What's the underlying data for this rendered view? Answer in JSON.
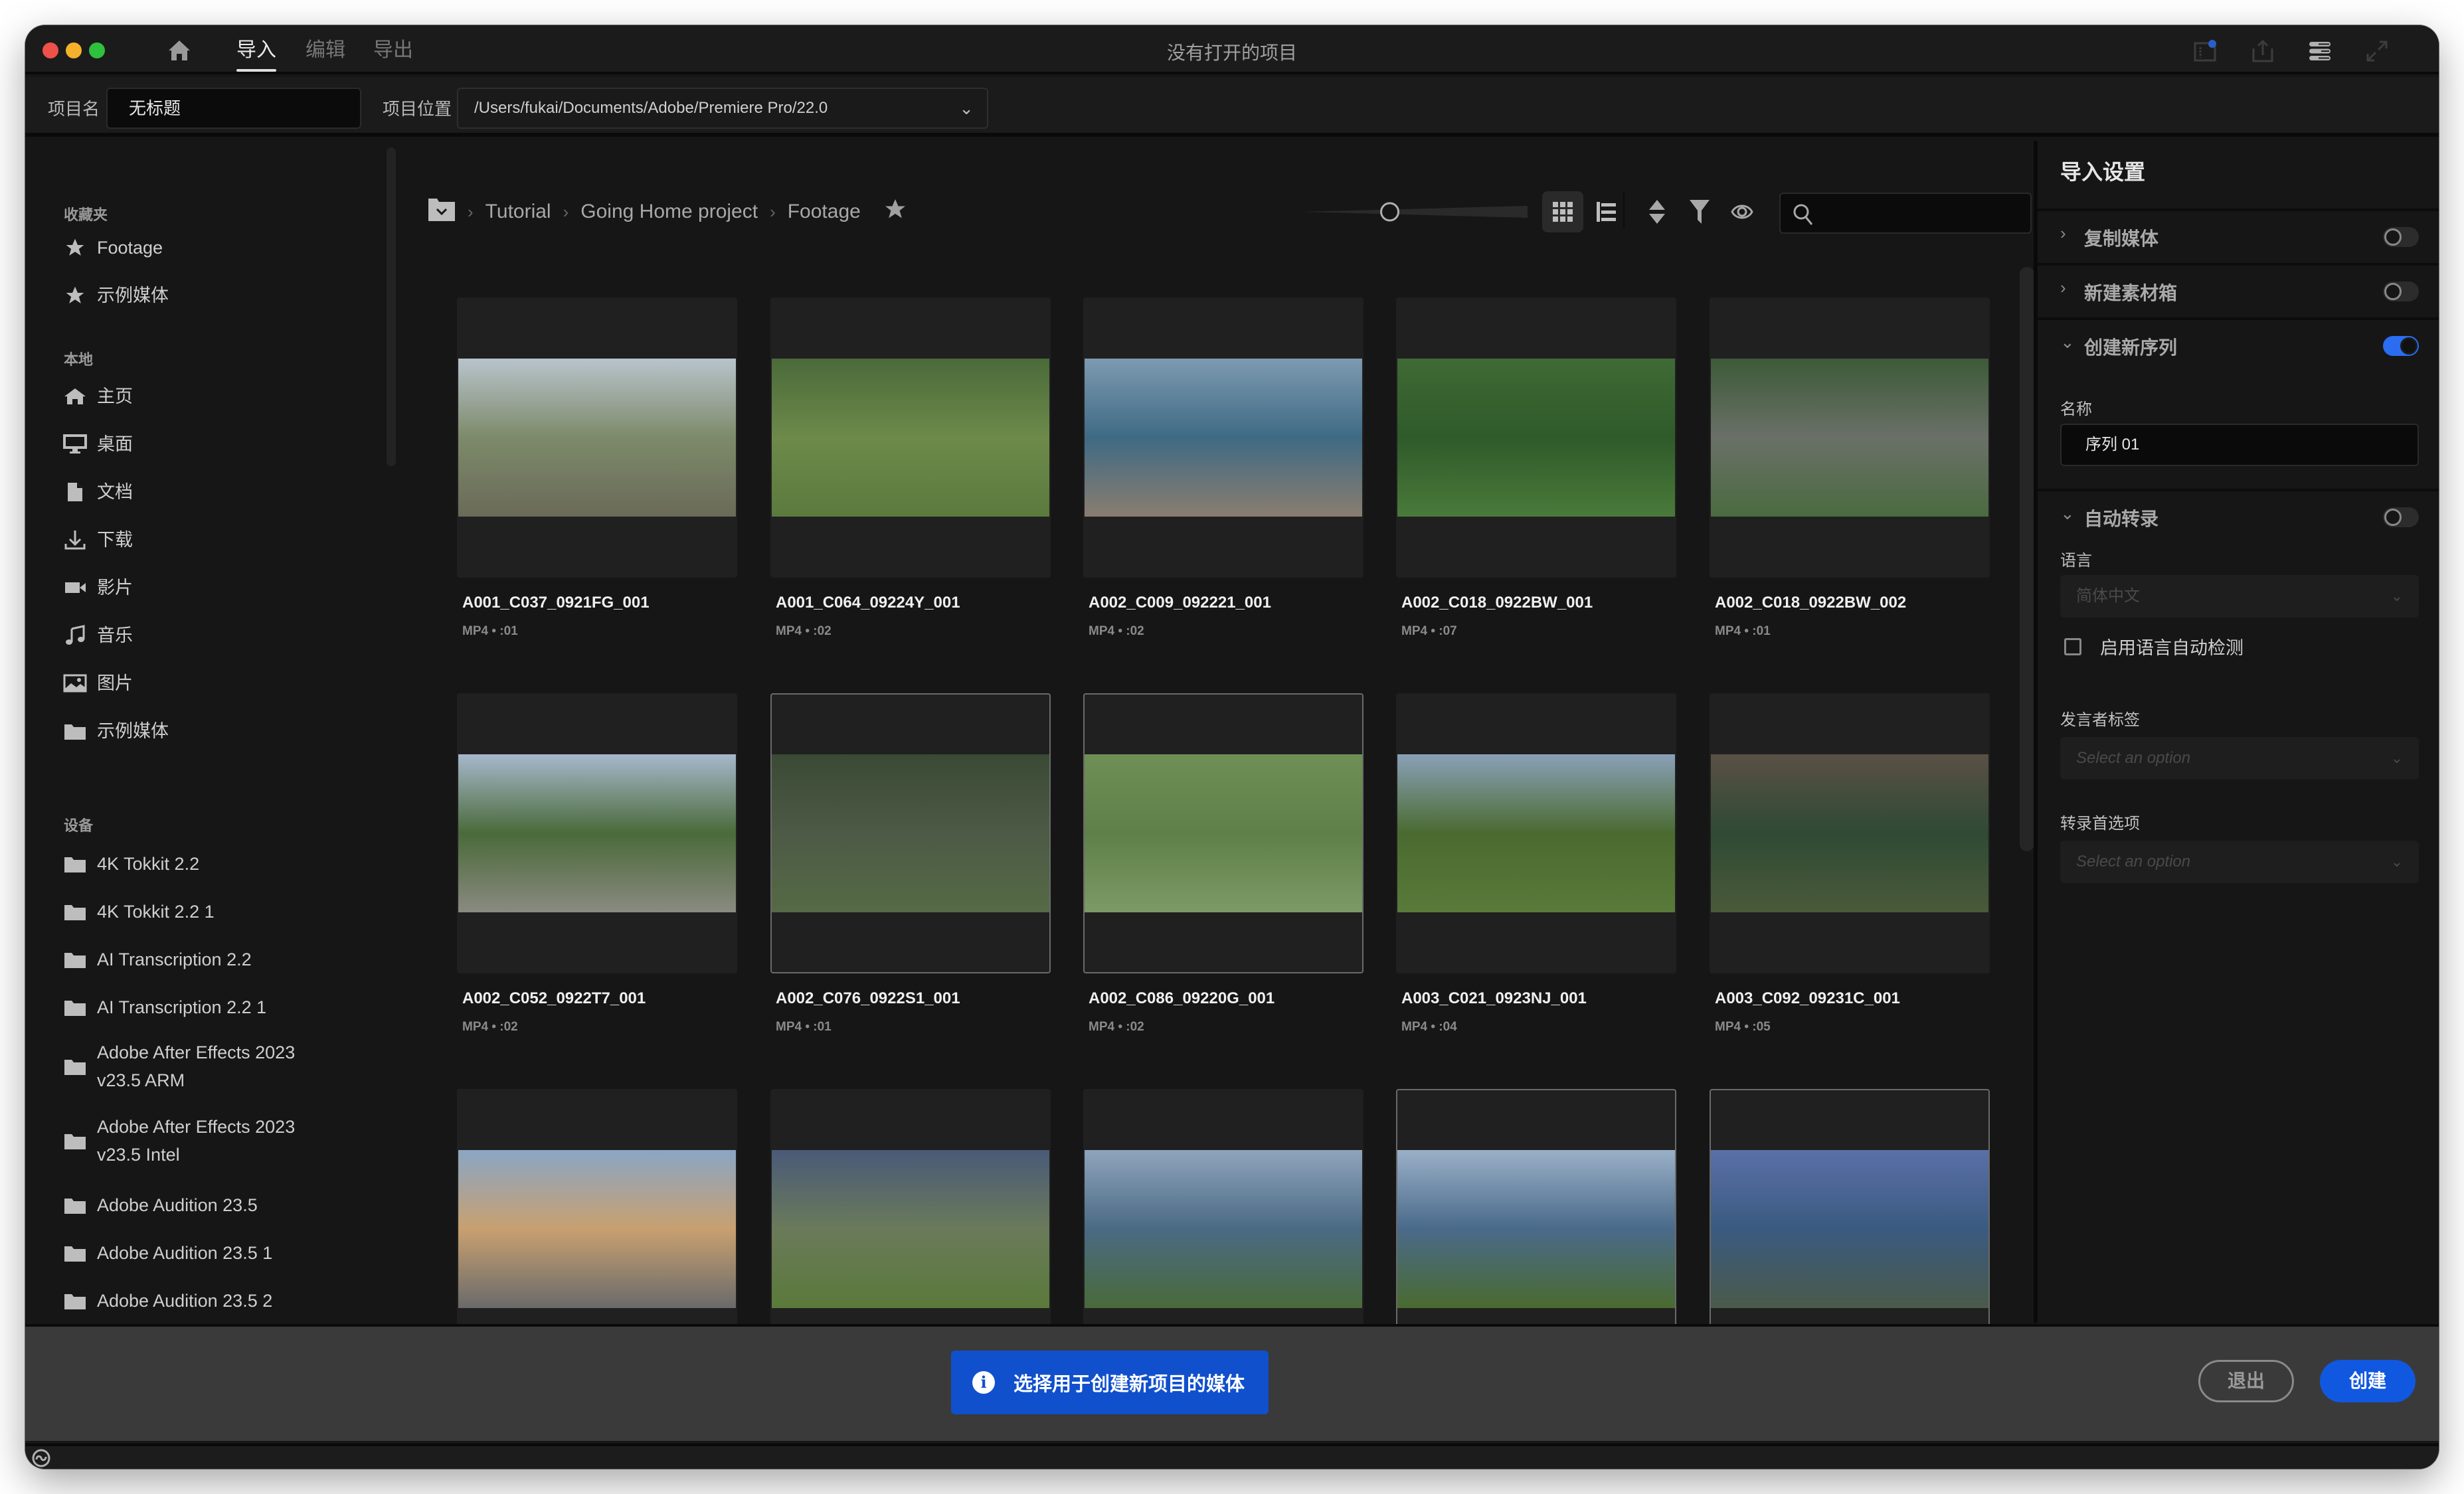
{
  "titlebar": {
    "window_title": "没有打开的项目",
    "tabs": [
      {
        "label": "导入",
        "active": true
      },
      {
        "label": "编辑",
        "active": false
      },
      {
        "label": "导出",
        "active": false
      }
    ],
    "right_icons": [
      "quick-export-icon",
      "share-icon",
      "workspaces-icon",
      "fullscreen-icon"
    ],
    "notification_dot_color": "#2a5fc9"
  },
  "project": {
    "name_label": "项目名",
    "name_value": "无标题",
    "location_label": "项目位置",
    "location_value": "/Users/fukai/Documents/Adobe/Premiere Pro/22.0"
  },
  "sidebar": {
    "favorites_heading": "收藏夹",
    "favorites": [
      {
        "label": "Footage",
        "icon": "star-icon"
      },
      {
        "label": "示例媒体",
        "icon": "star-icon"
      }
    ],
    "local_heading": "本地",
    "local": [
      {
        "label": "主页",
        "icon": "home-icon"
      },
      {
        "label": "桌面",
        "icon": "desktop-icon"
      },
      {
        "label": "文档",
        "icon": "document-icon"
      },
      {
        "label": "下载",
        "icon": "download-icon"
      },
      {
        "label": "影片",
        "icon": "video-camera-icon"
      },
      {
        "label": "音乐",
        "icon": "music-note-icon"
      },
      {
        "label": "图片",
        "icon": "image-icon"
      },
      {
        "label": "示例媒体",
        "icon": "folder-icon"
      }
    ],
    "devices_heading": "设备",
    "devices": [
      {
        "label": "4K Tokkit 2.2"
      },
      {
        "label": "4K Tokkit 2.2 1"
      },
      {
        "label": "AI Transcription 2.2"
      },
      {
        "label": "AI Transcription 2.2 1"
      },
      {
        "label": "Adobe After Effects 2023 v23.5 ARM"
      },
      {
        "label": "Adobe After Effects 2023 v23.5 Intel"
      },
      {
        "label": "Adobe Audition 23.5"
      },
      {
        "label": "Adobe Audition 23.5 1"
      },
      {
        "label": "Adobe Audition 23.5 2"
      }
    ]
  },
  "browser": {
    "breadcrumbs": [
      "Tutorial",
      "Going Home project",
      "Footage"
    ],
    "view_mode": "grid",
    "thumbnail_zoom": 0.38,
    "search_placeholder": "",
    "clips": [
      {
        "name": "A001_C037_0921FG_001",
        "meta": "MP4 • :01",
        "highlighted": false,
        "colors": [
          "#b8c4cc",
          "#7d8a6a",
          "#6a6a58"
        ]
      },
      {
        "name": "A001_C064_09224Y_001",
        "meta": "MP4 • :02",
        "highlighted": false,
        "colors": [
          "#4a6a3a",
          "#6d8a4a",
          "#5b7a3d"
        ]
      },
      {
        "name": "A002_C009_092221_001",
        "meta": "MP4 • :02",
        "highlighted": false,
        "colors": [
          "#7d9ab0",
          "#3f6a84",
          "#8a7d70"
        ]
      },
      {
        "name": "A002_C018_0922BW_001",
        "meta": "MP4 • :07",
        "highlighted": false,
        "colors": [
          "#3f6a35",
          "#2f5a2a",
          "#4a7a3a"
        ]
      },
      {
        "name": "A002_C018_0922BW_002",
        "meta": "MP4 • :01",
        "highlighted": false,
        "colors": [
          "#3d5a38",
          "#6a7068",
          "#4b6b40"
        ]
      },
      {
        "name": "A002_C052_0922T7_001",
        "meta": "MP4 • :02",
        "highlighted": false,
        "colors": [
          "#a6b8cc",
          "#4a6a3a",
          "#8a8a80"
        ]
      },
      {
        "name": "A002_C076_0922S1_001",
        "meta": "MP4 • :01",
        "highlighted": true,
        "colors": [
          "#3a4a34",
          "#4d5a46",
          "#556a45"
        ]
      },
      {
        "name": "A002_C086_09220G_001",
        "meta": "MP4 • :02",
        "highlighted": true,
        "colors": [
          "#6e8f55",
          "#5f8048",
          "#7c9a66"
        ]
      },
      {
        "name": "A003_C021_0923NJ_001",
        "meta": "MP4 • :04",
        "highlighted": false,
        "colors": [
          "#8aa0b8",
          "#4a6a30",
          "#5a7a3a"
        ]
      },
      {
        "name": "A003_C092_09231C_001",
        "meta": "MP4 • :05",
        "highlighted": false,
        "colors": [
          "#5a5045",
          "#2f4a35",
          "#4a5a3a"
        ]
      },
      {
        "name": "",
        "meta": "",
        "highlighted": false,
        "colors": [
          "#8aa6c4",
          "#c8a070",
          "#6a6a6a"
        ]
      },
      {
        "name": "",
        "meta": "",
        "highlighted": false,
        "colors": [
          "#4a5a78",
          "#6a7a5a",
          "#5a7a3a"
        ]
      },
      {
        "name": "",
        "meta": "",
        "highlighted": false,
        "colors": [
          "#8fa4bc",
          "#4a6a84",
          "#4a6a3a"
        ]
      },
      {
        "name": "",
        "meta": "",
        "highlighted": true,
        "colors": [
          "#9ab0c8",
          "#4a6a8a",
          "#4a6a30"
        ]
      },
      {
        "name": "",
        "meta": "",
        "highlighted": true,
        "colors": [
          "#5a70a8",
          "#3a5a80",
          "#4a5a4a"
        ]
      }
    ]
  },
  "import_settings": {
    "title": "导入设置",
    "sections": [
      {
        "label": "复制媒体",
        "expanded": false,
        "enabled": false
      },
      {
        "label": "新建素材箱",
        "expanded": false,
        "enabled": false
      },
      {
        "label": "创建新序列",
        "expanded": true,
        "enabled": true
      },
      {
        "label": "自动转录",
        "expanded": true,
        "enabled": false
      }
    ],
    "sequence_name_label": "名称",
    "sequence_name_value": "序列 01",
    "language_label": "语言",
    "language_value": "简体中文",
    "auto_detect_label": "启用语言自动检测",
    "auto_detect_checked": false,
    "speaker_label": "发言者标签",
    "speaker_placeholder": "Select an option",
    "transcription_pref_label": "转录首选项",
    "transcription_pref_placeholder": "Select an option"
  },
  "bottom": {
    "info_message": "选择用于创建新项目的媒体",
    "exit_label": "退出",
    "create_label": "创建",
    "accent_color": "#1158e0"
  }
}
